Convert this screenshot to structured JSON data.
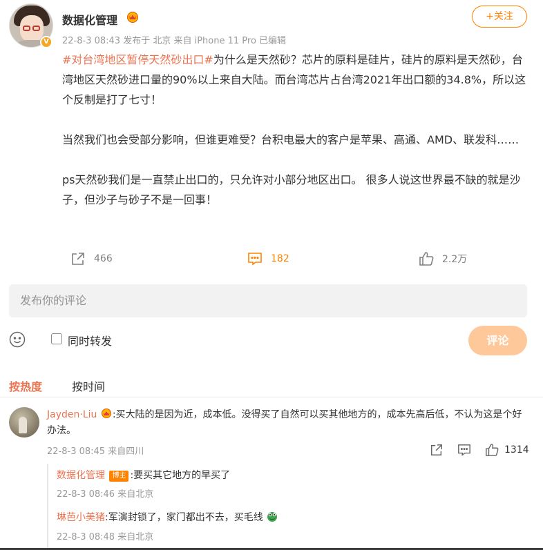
{
  "post": {
    "author": "数据化管理",
    "meta": "22-8-3 08:43  发布于 北京  来自 iPhone 11 Pro 已编辑",
    "follow_label": "+关注",
    "hashtag": "#对台湾地区暂停天然砂出口#",
    "paragraph1": "为什么是天然砂？芯片的原料是硅片，硅片的原料是天然砂，台湾地区天然砂进口量的90%以上来自大陆。而台湾芯片占台湾2021年出口额的34.8%，所以这个反制是打了七寸！",
    "paragraph2": "当然我们也会受部分影响，但谁更难受？台积电最大的客户是苹果、高通、AMD、联发科……",
    "paragraph3": "ps天然砂我们是一直禁止出口的，只允许对小部分地区出口。 很多人说这世界最不缺的就是沙子，但沙子与砂子不是一回事！"
  },
  "actions": {
    "repost_count": "466",
    "comment_count": "182",
    "like_count": "2.2万"
  },
  "composer": {
    "placeholder": "发布你的评论",
    "repost_label": "同时转发",
    "submit_label": "评论"
  },
  "sort": {
    "hot": "按热度",
    "time": "按时间"
  },
  "comments": [
    {
      "user": "Jayden·Liu",
      "text": ":买大陆的是因为近，成本低。没得买了自然可以买其他地方的，成本先高后低，不认为这是个好办法。",
      "meta": "22-8-3 08:45 来自四川",
      "likes": "1314",
      "replies": [
        {
          "user": "数据化管理",
          "badge": "博主",
          "text": ":要买其它地方的早买了",
          "meta": "22-8-3 08:46 来自北京"
        },
        {
          "user": "琳芭小美猪",
          "text": ":军演封锁了，家门都出不去，买毛线",
          "meta": "22-8-3 08:48 来自北京"
        }
      ]
    }
  ],
  "colors": {
    "accent": "#ff8200",
    "link": "#eb7350",
    "muted": "#999999"
  }
}
